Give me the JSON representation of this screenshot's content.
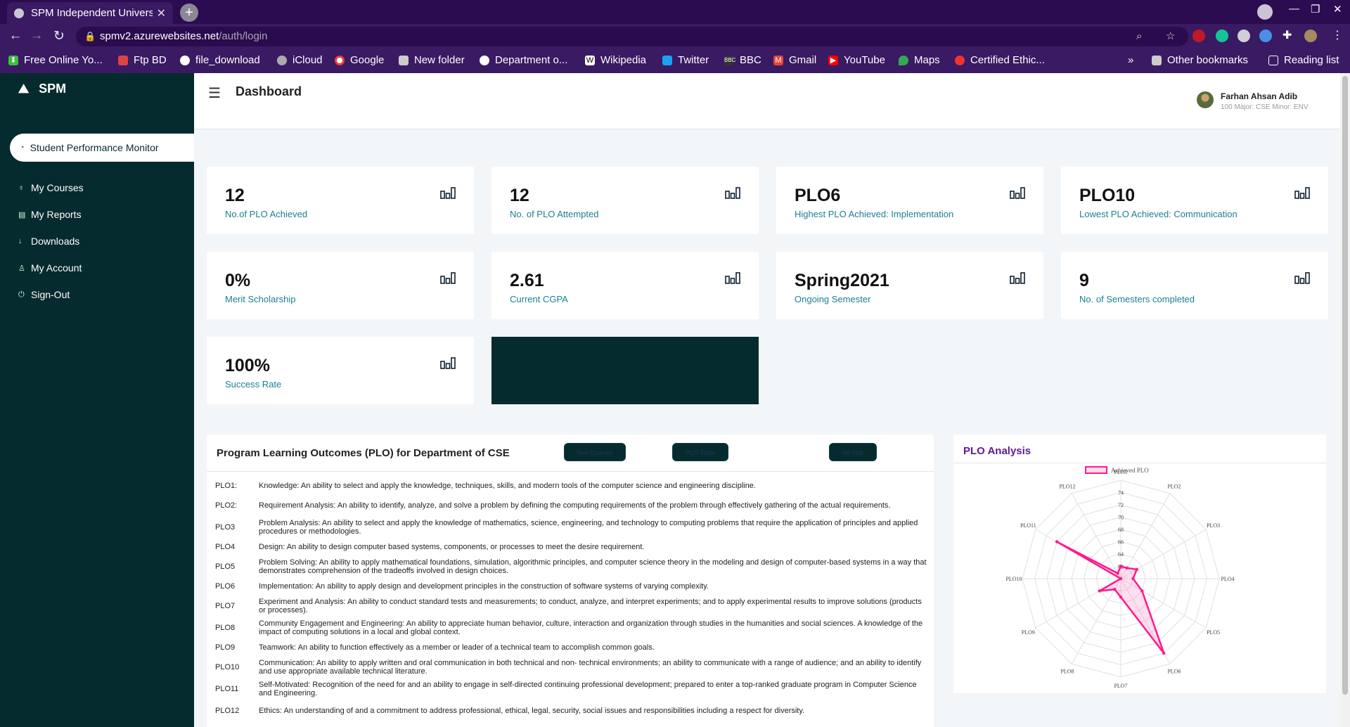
{
  "browser": {
    "tab_title": "SPM Independent Univers",
    "url_host": "spmv2.azurewebsites.net",
    "url_path": "/auth/login",
    "bookmarks": [
      "Free Online Yo...",
      "Ftp BD",
      "file_download",
      "iCloud",
      "Google",
      "New folder",
      "Department o...",
      "Wikipedia",
      "Twitter",
      "BBC",
      "Gmail",
      "YouTube",
      "Maps",
      "Certified Ethic...",
      "Other bookmarks",
      "Reading list"
    ],
    "overflow": "»"
  },
  "app": {
    "logo_text": "SPM",
    "active_nav": "Student Performance Monitor",
    "nav": [
      "My Courses",
      "My Reports",
      "Downloads",
      "My Account",
      "Sign-Out"
    ],
    "page_title": "Dashboard",
    "user_name": "Farhan Ahsan Adib",
    "user_meta": "100 Major: CSE Minor: ENV"
  },
  "stats": [
    {
      "value": "12",
      "label": "No.of PLO Achieved"
    },
    {
      "value": "12",
      "label": "No. of PLO Attempted"
    },
    {
      "value": "PLO6",
      "label": "Highest PLO Achieved: Implementation"
    },
    {
      "value": "PLO10",
      "label": "Lowest PLO Achieved: Communication"
    },
    {
      "value": "0%",
      "label": "Merit Scholarship"
    },
    {
      "value": "2.61",
      "label": "Current CGPA"
    },
    {
      "value": "Spring2021",
      "label": "Ongoing Semester"
    },
    {
      "value": "9",
      "label": "No. of Semesters completed"
    },
    {
      "value": "100%",
      "label": "Success Rate"
    }
  ],
  "plo_section": {
    "title": "Program Learning Outcomes (PLO) for Department of CSE",
    "buttons": [
      "See Courses",
      "PLO Table",
      "All Stat"
    ],
    "rows": [
      {
        "id": "PLO1:",
        "desc": "Knowledge: An ability to select and apply the knowledge, techniques, skills, and modern tools of the computer science and engineering discipline."
      },
      {
        "id": "PLO2:",
        "desc": "Requirement Analysis: An ability to identify, analyze, and solve a problem by defining the computing requirements of the problem through effectively gathering of the actual requirements."
      },
      {
        "id": "PLO3",
        "desc": "Problem Analysis: An ability to select and apply the knowledge of mathematics, science, engineering, and technology to computing problems that require the application of principles and applied procedures or methodologies."
      },
      {
        "id": "PLO4",
        "desc": "Design: An ability to design computer based systems, components, or processes to meet the desire requirement."
      },
      {
        "id": "PLO5",
        "desc": "Problem Solving: An ability to apply mathematical foundations, simulation, algorithmic principles, and computer science theory in the modeling and design of computer-based systems in a way that demonstrates comprehension of the tradeoffs involved in design choices."
      },
      {
        "id": "PLO6",
        "desc": "Implementation: An ability to apply design and development principles in the construction of software systems of varying complexity."
      },
      {
        "id": "PLO7",
        "desc": "Experiment and Analysis: An ability to conduct standard tests and measurements; to conduct, analyze, and interpret experiments; and to apply experimental results to improve solutions (products or processes)."
      },
      {
        "id": "PLO8",
        "desc": "Community Engagement and Engineering: An ability to appreciate human behavior, culture, interaction and organization through studies in the humanities and social sciences. A knowledge of the impact of computing solutions in a local and global context."
      },
      {
        "id": "PLO9",
        "desc": "Teamwork: An ability to function effectively as a member or leader of a technical team to accomplish common goals."
      },
      {
        "id": "PLO10",
        "desc": "Communication: An ability to apply written and oral communication in both technical and non- technical environments; an ability to communicate with a range of audience; and an ability to identify and use appropriate available technical literature."
      },
      {
        "id": "PLO11",
        "desc": "Self-Motivated: Recognition of the need for and an ability to engage in self-directed continuing professional development; prepared to enter a top-ranked graduate program in Computer Science and Engineering."
      },
      {
        "id": "PLO12",
        "desc": "Ethics: An understanding of and a commitment to address professional, ethical, legal, security, social issues and responsibilities including a respect for diversity."
      }
    ]
  },
  "chart_data": {
    "type": "radar",
    "title": "PLO Analysis",
    "legend": "Achieved PLO",
    "legend_position": "top",
    "categories": [
      "PLO1",
      "PLO2",
      "PLO3",
      "PLO4",
      "PLO5",
      "PLO6",
      "PLO7",
      "PLO8",
      "PLO9",
      "PLO10",
      "PLO11",
      "PLO12"
    ],
    "ticks": [
      "62",
      "64",
      "66",
      "68",
      "70",
      "72",
      "74"
    ],
    "range": [
      60,
      76
    ],
    "series": [
      {
        "name": "Achieved PLO",
        "values": [
          62,
          62,
          63,
          62,
          64,
          74,
          63,
          62,
          64,
          60,
          72,
          61
        ]
      }
    ],
    "colors": {
      "line": "#ff1a8c",
      "fill": "rgba(255,105,180,0.22)"
    }
  }
}
